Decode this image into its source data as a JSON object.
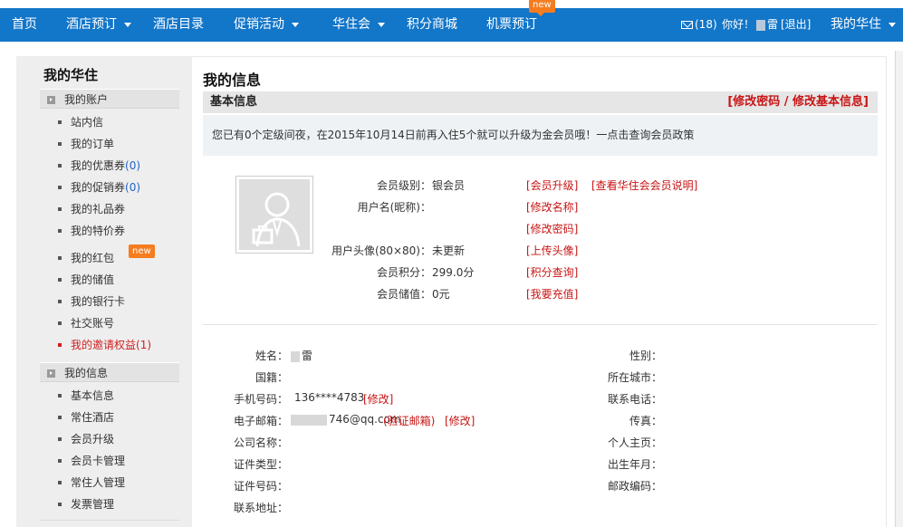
{
  "nav": {
    "items": [
      {
        "label": "首页",
        "dropdown": false
      },
      {
        "label": "酒店预订",
        "dropdown": true
      },
      {
        "label": "酒店目录",
        "dropdown": false
      },
      {
        "label": "促销活动",
        "dropdown": true
      },
      {
        "label": "华住会",
        "dropdown": true
      },
      {
        "label": "积分商城",
        "dropdown": false
      },
      {
        "label": "机票预订",
        "dropdown": false
      }
    ],
    "new_badge": "new",
    "mail_count": "(18)",
    "greeting": "你好！",
    "user_name": "雷",
    "logout": "[退出]",
    "my_huazhu": "我的华住"
  },
  "sidebar": {
    "title": "我的华住",
    "account_group": "我的账户",
    "account_items": [
      {
        "label": "站内信",
        "count": ""
      },
      {
        "label": "我的订单",
        "count": ""
      },
      {
        "label": "我的优惠券",
        "count": "(0)"
      },
      {
        "label": "我的促销券",
        "count": "(0)"
      },
      {
        "label": "我的礼品券",
        "count": ""
      },
      {
        "label": "我的特价券",
        "count": ""
      },
      {
        "label": "我的红包",
        "count": ""
      },
      {
        "label": "我的储值",
        "count": ""
      },
      {
        "label": "我的银行卡",
        "count": ""
      },
      {
        "label": "社交账号",
        "count": ""
      },
      {
        "label": "我的邀请权益",
        "count": "(1)"
      }
    ],
    "red_packet_badge": "new",
    "info_group": "我的信息",
    "info_items": [
      "基本信息",
      "常住酒店",
      "会员升级",
      "会员卡管理",
      "常住人管理",
      "发票管理"
    ]
  },
  "main": {
    "title": "我的信息",
    "section_label": "基本信息",
    "section_links": "[修改密码 / 修改基本信息]",
    "notice": "您已有0个定级间夜，在2015年10月14日前再入住5个就可以升级为金会员哦！一点击查询会员政策",
    "membership": {
      "level_label": "会员级别：",
      "level_value": "银会员",
      "upgrade_link": "[会员升级]",
      "explain_link": "[查看华住会会员说明]",
      "username_label": "用户名(昵称)：",
      "rename_link": "[修改名称]",
      "password_link": "[修改密码]",
      "avatar_label": "用户头像(80×80)：",
      "avatar_value": "未更新",
      "upload_link": "[上传头像]",
      "points_label": "会员积分：",
      "points_value": "299.0分",
      "points_link": "[积分查询]",
      "balance_label": "会员储值：",
      "balance_value": "0元",
      "recharge_link": "[我要充值]"
    },
    "profile": {
      "name_label": "姓名：",
      "name_value": "雷",
      "nationality_label": "国籍：",
      "mobile_label": "手机号码：",
      "mobile_value": "136****4783",
      "mobile_edit": "[修改]",
      "email_label": "电子邮箱：",
      "email_value": "746@qq.com",
      "email_verify": "(验证邮箱)",
      "email_edit": "[修改]",
      "company_label": "公司名称：",
      "idtype_label": "证件类型：",
      "idnum_label": "证件号码：",
      "address_label": "联系地址：",
      "gender_label": "性别：",
      "city_label": "所在城市：",
      "phone_label": "联系电话：",
      "fax_label": "传真：",
      "homepage_label": "个人主页：",
      "birth_label": "出生年月：",
      "zip_label": "邮政编码："
    }
  }
}
